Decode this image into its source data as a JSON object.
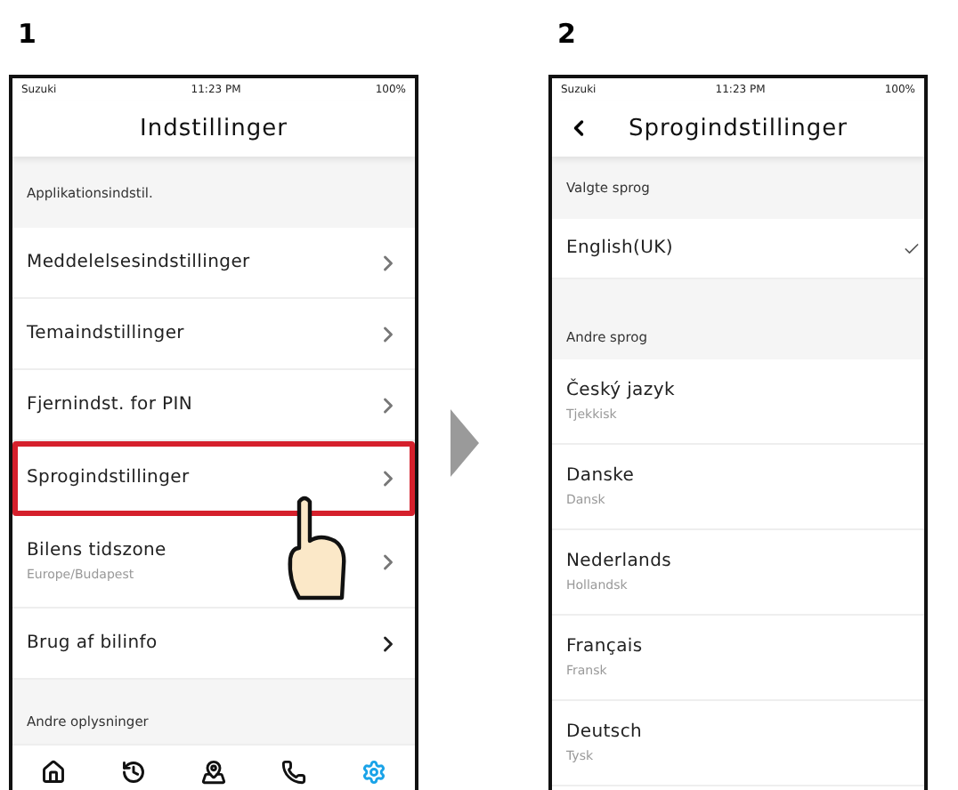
{
  "steps": [
    {
      "number": "1",
      "status": {
        "carrier": "Suzuki",
        "time": "11:23 PM",
        "battery": "100%"
      },
      "title": "Indstillinger",
      "back": false,
      "sections": [
        {
          "header": "Applikationsindstil.",
          "rows": [
            {
              "label": "Meddelelsesindstillinger",
              "highlighted": false
            },
            {
              "label": "Temaindstillinger",
              "highlighted": false
            },
            {
              "label": "Fjernindst. for PIN",
              "highlighted": false
            },
            {
              "label": "Sprogindstillinger",
              "highlighted": true
            },
            {
              "label": "Bilens tidszone",
              "sub": "Europe/Budapest",
              "highlighted": false
            },
            {
              "label": "Brug af bilinfo",
              "highlighted": false
            }
          ]
        },
        {
          "header": "Andre oplysninger"
        }
      ],
      "tabs": [
        {
          "selected": false
        },
        {
          "selected": false
        },
        {
          "selected": false
        },
        {
          "selected": false
        },
        {
          "selected": true
        }
      ]
    },
    {
      "number": "2",
      "status": {
        "carrier": "Suzuki",
        "time": "11:23 PM",
        "battery": "100%"
      },
      "title": "Sprogindstillinger",
      "back": true,
      "sections": [
        {
          "header": "Valgte sprog",
          "rows": [
            {
              "label": "English(UK)",
              "checked": true
            }
          ]
        },
        {
          "header": "Andre sprog",
          "rows": [
            {
              "label": "Český jazyk",
              "sub": "Tjekkisk",
              "checked": false
            },
            {
              "label": "Danske",
              "sub": "Dansk",
              "checked": false
            },
            {
              "label": "Nederlands",
              "sub": "Hollandsk",
              "checked": false
            },
            {
              "label": "Français",
              "sub": "Fransk",
              "checked": false
            },
            {
              "label": "Deutsch",
              "sub": "Tysk",
              "checked": false
            }
          ]
        }
      ]
    }
  ]
}
